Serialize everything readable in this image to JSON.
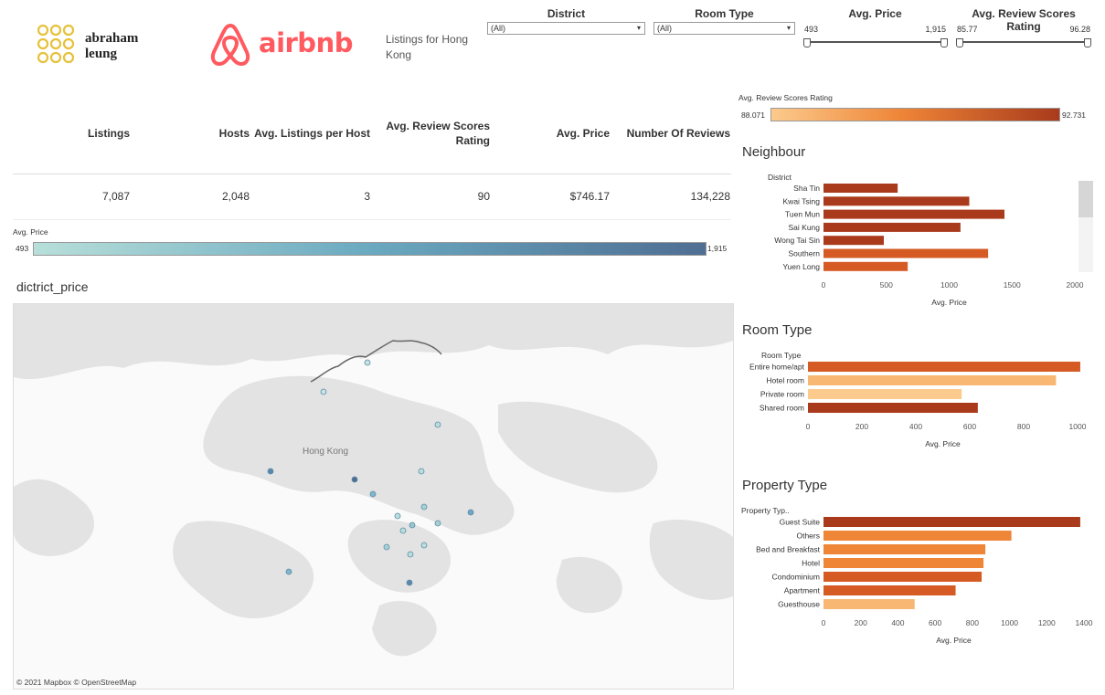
{
  "brand": {
    "name_line1": "abraham",
    "name_line2": "leung",
    "airbnb_word": "airbnb",
    "subtitle": "Listings for Hong Kong"
  },
  "filters": {
    "district": {
      "title": "District",
      "value": "(All)"
    },
    "room_type": {
      "title": "Room Type",
      "value": "(All)"
    },
    "avg_price": {
      "title": "Avg. Price",
      "min": "493",
      "max": "1,915"
    },
    "avg_review": {
      "title": "Avg. Review Scores Rating",
      "min": "85.77",
      "max": "96.28"
    }
  },
  "kpi": {
    "headers": [
      "Listings",
      "Hosts",
      "Avg. Listings per Host",
      "Avg. Review Scores Rating",
      "Avg. Price",
      "Number Of Reviews"
    ],
    "values": [
      "7,087",
      "2,048",
      "3",
      "90",
      "$746.17",
      "134,228"
    ]
  },
  "review_legend": {
    "title": "Avg. Review Scores Rating",
    "min": "88.071",
    "max": "92.731"
  },
  "price_legend": {
    "title": "Avg. Price",
    "min": "493",
    "max": "1,915"
  },
  "map": {
    "title": "dictrict_price",
    "place_label": "Hong Kong",
    "attribution": "© 2021 Mapbox  © OpenStreetMap"
  },
  "colors": {
    "dark_orange": "#a93a1c",
    "orange": "#d55a23",
    "mid_orange": "#ee8537",
    "light_orange": "#f8b874",
    "pale_orange": "#fcca8c",
    "teal_light": "#b8dfd9",
    "teal_dark": "#4f6e93"
  },
  "chart_data": [
    {
      "type": "bar",
      "title": "Neighbour",
      "category_header": "District",
      "xlabel": "Avg. Price",
      "categories": [
        "Sha Tin",
        "Kwai Tsing",
        "Tuen Mun",
        "Sai Kung",
        "Wong Tai Sin",
        "Southern",
        "Yuen Long"
      ],
      "values": [
        590,
        1160,
        1440,
        1090,
        480,
        1310,
        670
      ],
      "xlim": [
        0,
        2000
      ],
      "ticks": [
        "0",
        "500",
        "1000",
        "1500",
        "2000"
      ]
    },
    {
      "type": "bar",
      "title": "Room Type",
      "category_header": "Room Type",
      "xlabel": "Avg. Price",
      "categories": [
        "Entire home/apt",
        "Hotel room",
        "Private room",
        "Shared room"
      ],
      "values": [
        1010,
        920,
        570,
        630
      ],
      "xlim": [
        0,
        1000
      ],
      "ticks": [
        "0",
        "200",
        "400",
        "600",
        "800",
        "1000"
      ]
    },
    {
      "type": "bar",
      "title": "Property Type",
      "category_header": "Property Typ..",
      "xlabel": "Avg. Price",
      "categories": [
        "Guest Suite",
        "Others",
        "Bed and Breakfast",
        "Hotel",
        "Condominium",
        "Apartment",
        "Guesthouse"
      ],
      "values": [
        1380,
        1010,
        870,
        860,
        850,
        710,
        490
      ],
      "xlim": [
        0,
        1400
      ],
      "ticks": [
        "0",
        "200",
        "400",
        "600",
        "800",
        "1000",
        "1200",
        "1400"
      ]
    }
  ]
}
